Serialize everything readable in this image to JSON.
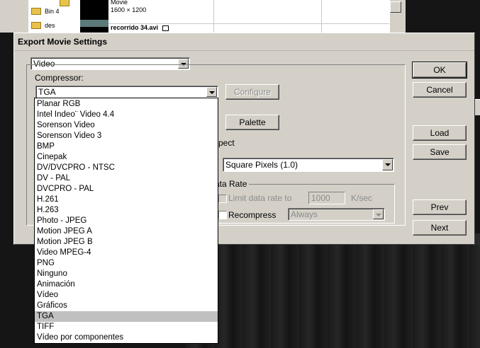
{
  "background_window": {
    "bins": [
      {
        "label": ""
      },
      {
        "label": "Bin 4"
      },
      {
        "label": "des"
      }
    ],
    "clip_meta": "Movie",
    "clip_size": "1600 × 1200",
    "clip_name": "recorrido 34.avi"
  },
  "dialog": {
    "title": "Export Movie Settings",
    "category_select": "Video",
    "compressor_label": "Compressor:",
    "compressor_value": "TGA",
    "configure_button": "Configure",
    "palette_button": "Palette",
    "aspect_label_partial": "pect",
    "pixel_aspect_value": "Square Pixels (1.0)",
    "data_rate_group_label": "ata Rate",
    "limit_data_rate_label": "Limit data rate to",
    "limit_data_rate_value": "1000",
    "limit_data_rate_unit": "K/sec",
    "recompress_label": "Recompress",
    "recompress_value": "Always",
    "buttons": {
      "ok": "OK",
      "cancel": "Cancel",
      "load": "Load",
      "save": "Save",
      "prev": "Prev",
      "next": "Next"
    }
  },
  "compressor_options": [
    "Planar RGB",
    "Intel Indeo¨ Video 4.4",
    "Sorenson Video",
    "Sorenson Video 3",
    "BMP",
    "Cinepak",
    "DV/DVCPRO - NTSC",
    "DV - PAL",
    "DVCPRO - PAL",
    "H.261",
    "H.263",
    "Photo - JPEG",
    "Motion JPEG A",
    "Motion JPEG B",
    "Video MPEG-4",
    "PNG",
    "Ninguno",
    "Animación",
    "Vídeo",
    "Gráficos",
    "TGA",
    "TIFF",
    "Vídeo por componentes"
  ],
  "selected_option": "TGA"
}
